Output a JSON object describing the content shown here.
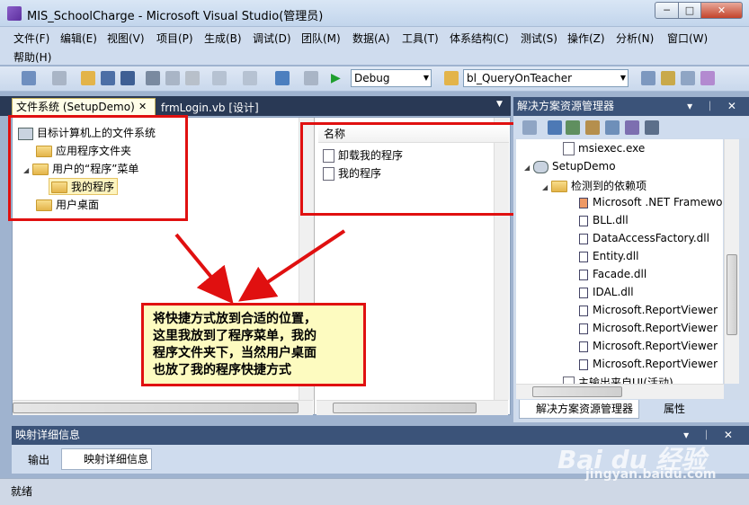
{
  "window": {
    "title": "MIS_SchoolCharge - Microsoft Visual Studio(管理员)",
    "min": "─",
    "max": "□",
    "close": "✕"
  },
  "menu": [
    "文件(F)",
    "编辑(E)",
    "视图(V)",
    "项目(P)",
    "生成(B)",
    "调试(D)",
    "团队(M)",
    "数据(A)",
    "工具(T)",
    "体系结构(C)",
    "测试(S)",
    "操作(Z)",
    "分析(N)",
    "窗口(W)",
    "帮助(H)"
  ],
  "toolbar": {
    "config": "Debug",
    "find": "bl_QueryOnTeacher"
  },
  "doc_tabs": {
    "active": "文件系统 (SetupDemo)",
    "close": "✕",
    "other": "frmLogin.vb [设计]",
    "dropdown": "▼"
  },
  "fs_tree": [
    {
      "label": "目标计算机上的文件系统",
      "icon": "computer-icon"
    },
    {
      "label": "应用程序文件夹",
      "icon": "folder-icon"
    },
    {
      "label": "用户的“程序”菜单",
      "icon": "folder-icon",
      "expander": "◢"
    },
    {
      "label": "我的程序",
      "icon": "folder-open-icon"
    },
    {
      "label": "用户桌面",
      "icon": "folder-icon"
    }
  ],
  "list": {
    "header": "名称",
    "items": [
      "卸载我的程序",
      "我的程序"
    ]
  },
  "solution": {
    "title": "解决方案资源管理器",
    "controls": "▾ ᛁ ✕",
    "items": [
      {
        "label": "msiexec.exe"
      },
      {
        "label": "SetupDemo",
        "expander": "◢"
      },
      {
        "label": "检测到的依赖项",
        "expander": "◢"
      },
      {
        "label": "Microsoft .NET Framewo"
      },
      {
        "label": "BLL.dll"
      },
      {
        "label": "DataAccessFactory.dll"
      },
      {
        "label": "Entity.dll"
      },
      {
        "label": "Facade.dll"
      },
      {
        "label": "IDAL.dll"
      },
      {
        "label": "Microsoft.ReportViewer"
      },
      {
        "label": "Microsoft.ReportViewer"
      },
      {
        "label": "Microsoft.ReportViewer"
      },
      {
        "label": "Microsoft.ReportViewer"
      },
      {
        "label": "主输出来自UI(活动)"
      }
    ],
    "bottom_tabs": [
      "解决方案资源管理器",
      "属性"
    ]
  },
  "bottom_panel": {
    "title": "映射详细信息",
    "controls": "▾ ᛁ ✕",
    "tabs": [
      "输出",
      "映射详细信息"
    ]
  },
  "status": "就绪",
  "annotation": {
    "lines": [
      "将快捷方式放到合适的位置，",
      "这里我放到了程序菜单，我的",
      "程序文件夹下，当然用户桌面",
      "也放了我的程序快捷方式"
    ]
  },
  "watermark": {
    "logo": "Bai du 经验",
    "url": "jingyan.baidu.com"
  },
  "colors": {
    "accent_red": "#e01010",
    "header_navy": "#3b5379",
    "note_bg": "#fdfbc0"
  }
}
